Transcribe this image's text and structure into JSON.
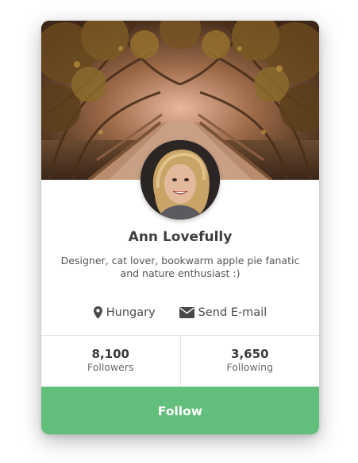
{
  "profile": {
    "name": "Ann Lovefully",
    "bio": "Designer, cat lover, bookwarm apple pie fanatic and nature enthusiast :)",
    "location": "Hungary",
    "email_label": "Send E-mail"
  },
  "stats": [
    {
      "value": "8,100",
      "label": "Followers"
    },
    {
      "value": "3,650",
      "label": "Following"
    }
  ],
  "actions": {
    "follow_label": "Follow"
  },
  "icons": {
    "location": "map-marker-icon",
    "email": "envelope-icon"
  },
  "colors": {
    "accent": "#62be7b",
    "text": "#3e3e3e"
  }
}
